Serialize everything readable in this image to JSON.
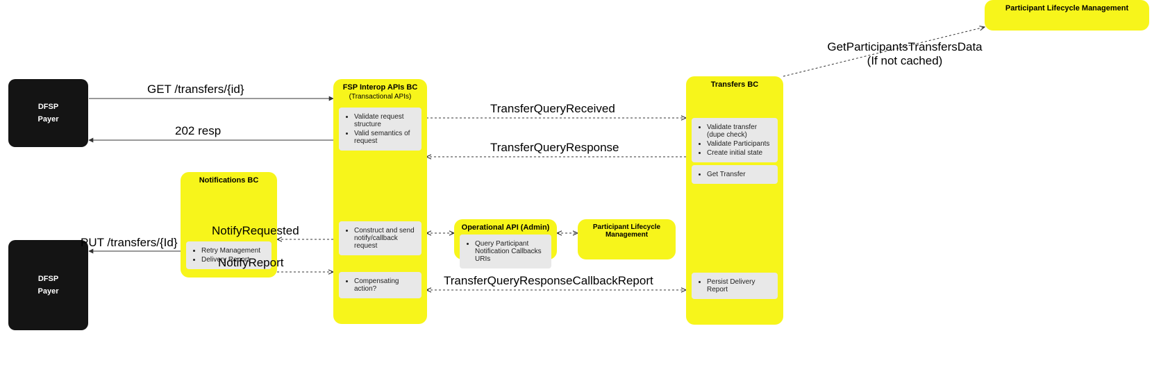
{
  "dfsp1": {
    "line1": "DFSP",
    "line2": "Payer"
  },
  "dfsp2": {
    "line1": "DFSP",
    "line2": "Payer"
  },
  "fsp": {
    "title": "FSP Interop APIs BC",
    "subtitle": "(Transactional APIs)",
    "box1_items": [
      "Validate request structure",
      "Valid semantics of request"
    ],
    "box2_items": [
      "Construct and send notify/callback request"
    ],
    "box3_items": [
      "Compensating action?"
    ]
  },
  "notifications": {
    "title": "Notifications BC",
    "box1_items": [
      "Retry Management",
      "Delivery Report"
    ]
  },
  "opapi": {
    "title": "Operational API (Admin)",
    "box1_items": [
      "Query Participant Notification Callbacks URIs"
    ]
  },
  "plm_mid": {
    "title": "Participant Lifecycle Management"
  },
  "plm_top": {
    "title": "Participant Lifecycle Management"
  },
  "transfers": {
    "title": "Transfers BC",
    "box1_items": [
      "Validate transfer (dupe check)",
      "Validate Participants",
      "Create initial state"
    ],
    "box2_items": [
      "Get Transfer"
    ],
    "box3_items": [
      "Persist Delivery Report"
    ]
  },
  "edges": {
    "get_transfers": "GET /transfers/{id}",
    "resp_202": "202 resp",
    "tq_received": "TransferQueryReceived",
    "tq_response": "TransferQueryResponse",
    "notify_requested": "NotifyRequested",
    "notify_report": "NotifyReport",
    "put_transfers": "PUT /transfers/{Id}",
    "tq_cb_report": "TransferQueryResponseCallbackReport",
    "gp_transfers_data_l1": "GetParticipantsTransfersData",
    "gp_transfers_data_l2": "(If not cached)"
  }
}
